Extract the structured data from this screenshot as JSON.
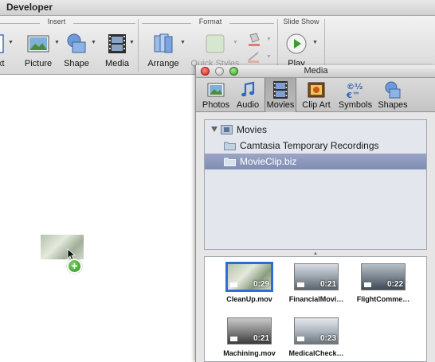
{
  "app": {
    "active_tab": "Developer"
  },
  "ribbon": {
    "groups": {
      "insert": "Insert",
      "format": "Format",
      "slideshow": "Slide Show"
    },
    "buttons": {
      "text_partial": "xt",
      "picture": "Picture",
      "shape": "Shape",
      "media": "Media",
      "arrange": "Arrange",
      "quick_styles": "Quick Styles",
      "play": "Play"
    }
  },
  "media_panel": {
    "title": "Media",
    "tabs": [
      "Photos",
      "Audio",
      "Movies",
      "Clip Art",
      "Symbols",
      "Shapes"
    ],
    "active_tab": "Movies",
    "tree": {
      "root": "Movies",
      "items": [
        "Camtasia Temporary Recordings",
        "MovieClip.biz"
      ],
      "selected": "MovieClip.biz"
    },
    "movies": [
      {
        "name": "CleanUp.mov",
        "duration": "0:29",
        "selected": true
      },
      {
        "name": "FinancialMovi…",
        "duration": "0:21",
        "selected": false
      },
      {
        "name": "FlightComme…",
        "duration": "0:22",
        "selected": false
      },
      {
        "name": "Machining.mov",
        "duration": "0:21",
        "selected": false
      },
      {
        "name": "MedicalCheck…",
        "duration": "0:23",
        "selected": false
      }
    ]
  },
  "colors": {
    "selection_blue": "#2b6fd6",
    "tree_selection": "#8a97bb"
  }
}
